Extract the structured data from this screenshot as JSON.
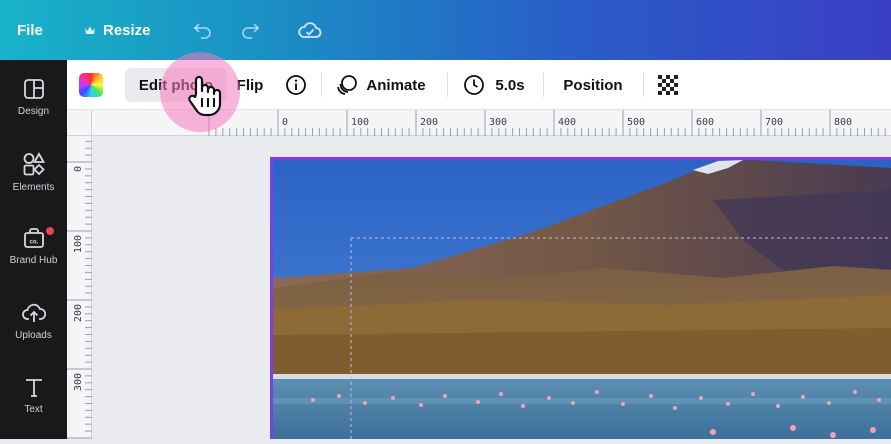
{
  "topbar": {
    "file_label": "File",
    "resize_label": "Resize",
    "resize_icon": "crown-icon",
    "undo_icon": "undo-icon",
    "redo_icon": "redo-icon",
    "save_status_icon": "cloud-check-icon"
  },
  "sidebar": {
    "items": [
      {
        "label": "Design",
        "icon": "layout-icon"
      },
      {
        "label": "Elements",
        "icon": "shapes-icon"
      },
      {
        "label": "Brand Hub",
        "icon": "brand-hub-icon"
      },
      {
        "label": "Uploads",
        "icon": "cloud-upload-icon"
      },
      {
        "label": "Text",
        "icon": "text-icon"
      }
    ]
  },
  "toolbar": {
    "color_icon": "color-picker-icon",
    "edit_photo_label": "Edit photo",
    "flip_label": "Flip",
    "info_icon": "info-icon",
    "animate_label": "Animate",
    "duration_label": "5.0s",
    "position_label": "Position",
    "transparency_icon": "transparency-icon"
  },
  "ruler": {
    "top_labels": [
      "0",
      "100",
      "200",
      "300",
      "400",
      "500",
      "600",
      "700",
      "800"
    ],
    "left_labels": [
      "0",
      "100",
      "200",
      "300"
    ]
  },
  "colors": {
    "accent": "#7c3ee6",
    "sidebar_bg": "#18191b",
    "highlight": "#f578be"
  }
}
